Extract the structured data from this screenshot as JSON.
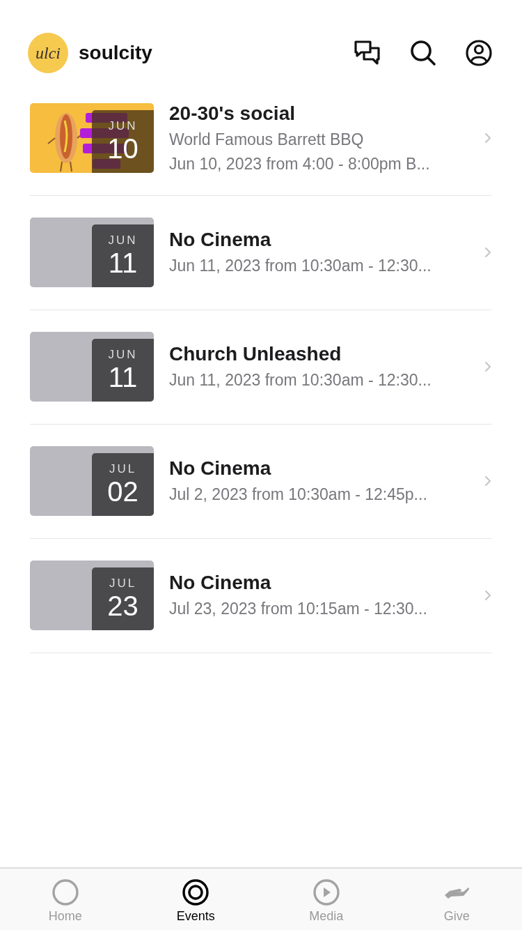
{
  "header": {
    "logo_text": "ulci",
    "name": "soulcity"
  },
  "events": [
    {
      "kind": "picture",
      "month": "JUN",
      "day": "10",
      "title": "20-30's social",
      "subtitle": "World Famous Barrett BBQ",
      "when": "Jun 10, 2023 from 4:00 - 8:00pm B..."
    },
    {
      "month": "JUN",
      "day": "11",
      "title": "No Cinema",
      "when": "Jun 11, 2023 from 10:30am - 12:30..."
    },
    {
      "month": "JUN",
      "day": "11",
      "title": "Church Unleashed",
      "when": "Jun 11, 2023 from 10:30am - 12:30..."
    },
    {
      "month": "JUL",
      "day": "02",
      "title": "No Cinema",
      "when": "Jul 2, 2023 from 10:30am - 12:45p..."
    },
    {
      "month": "JUL",
      "day": "23",
      "title": "No Cinema",
      "when": "Jul 23, 2023 from 10:15am - 12:30..."
    }
  ],
  "tabs": [
    {
      "kind": "home",
      "label": "Home",
      "selected": false
    },
    {
      "kind": "events",
      "label": "Events",
      "selected": true
    },
    {
      "kind": "media",
      "label": "Media",
      "selected": false
    },
    {
      "kind": "give",
      "label": "Give",
      "selected": false
    }
  ]
}
